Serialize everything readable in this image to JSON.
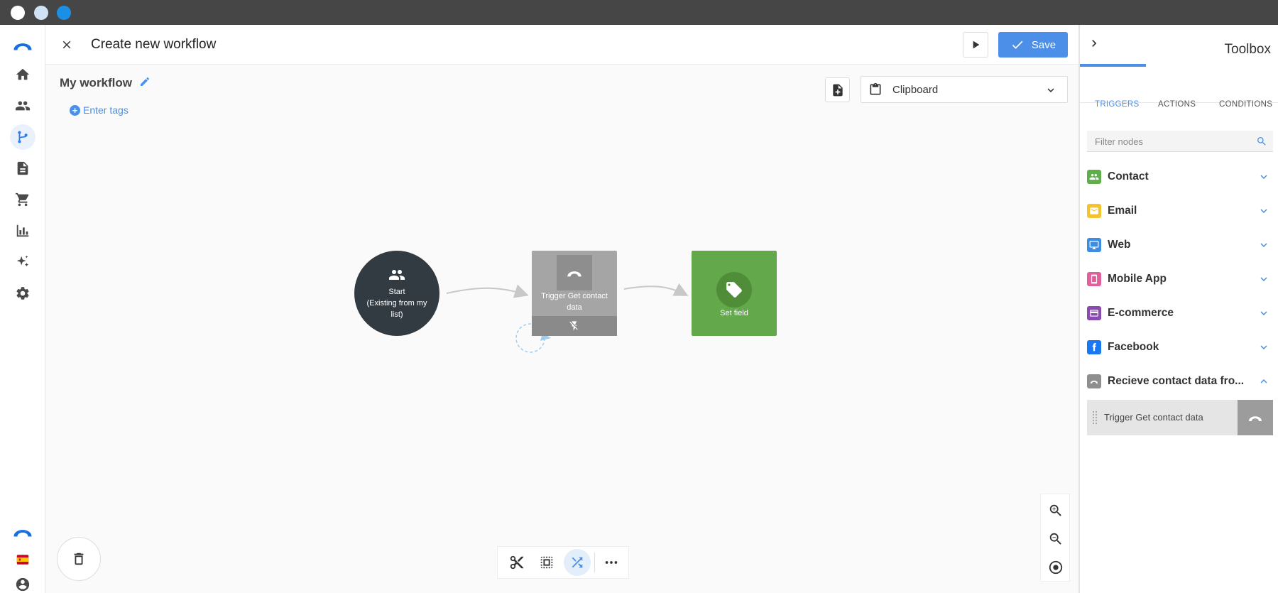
{
  "header": {
    "title": "Create new workflow",
    "save_label": "Save"
  },
  "canvas": {
    "workflow_name": "My workflow",
    "tags_label": "Enter tags",
    "clipboard_label": "Clipboard"
  },
  "nodes": {
    "start": {
      "line1": "Start",
      "line2": "(Existing from my list)"
    },
    "trigger": {
      "label": "Trigger Get contact data"
    },
    "setfield": {
      "label": "Set field"
    }
  },
  "toolbox": {
    "title": "Toolbox",
    "tabs": [
      "TRIGGERS",
      "ACTIONS",
      "CONDITIONS"
    ],
    "active_tab": "TRIGGERS",
    "filter_placeholder": "Filter nodes",
    "categories": [
      {
        "label": "Contact",
        "color": "#5fae4a",
        "icon": "people-icon",
        "expanded": false
      },
      {
        "label": "Email",
        "color": "#f4c430",
        "icon": "mail-icon",
        "expanded": false
      },
      {
        "label": "Web",
        "color": "#3d8ee0",
        "icon": "monitor-icon",
        "expanded": false
      },
      {
        "label": "Mobile App",
        "color": "#e0609a",
        "icon": "mobile-icon",
        "expanded": false
      },
      {
        "label": "E-commerce",
        "color": "#8a4bb0",
        "icon": "card-icon",
        "expanded": false
      },
      {
        "label": "Facebook",
        "color": "#1877f2",
        "icon": "facebook-icon",
        "expanded": false
      },
      {
        "label": "Recieve contact data fro...",
        "color": "#8e8e8e",
        "icon": "webhook-icon",
        "expanded": true
      }
    ],
    "expanded_item": {
      "label": "Trigger Get contact data"
    }
  },
  "colors": {
    "accent": "#4b8fe8",
    "start_node": "#333b42",
    "trigger_node": "#a5a5a5",
    "setfield_node": "#63a84a"
  }
}
